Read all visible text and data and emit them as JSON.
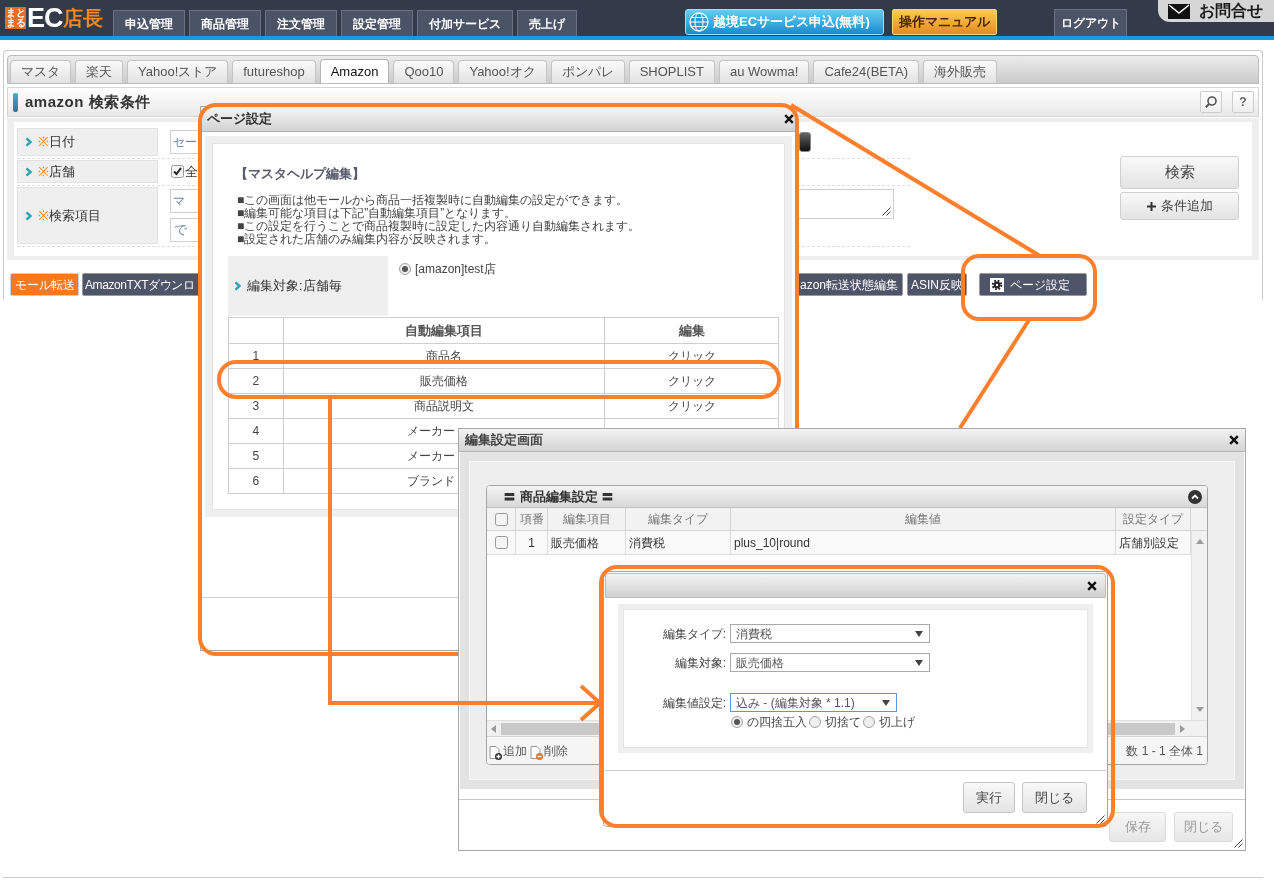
{
  "header": {
    "logo": {
      "badge": [
        "まと",
        "まる"
      ],
      "brand": "EC",
      "brand_accent": "店長"
    },
    "menu": [
      "申込管理",
      "商品管理",
      "注文管理",
      "設定管理",
      "付加サービス",
      "売上げ"
    ],
    "promo_button": "越境ECサービス申込(無料)",
    "manual_button": "操作マニュアル",
    "logout_button": "ログアウト",
    "contact_tab": "お問合せ"
  },
  "mall_tabs": [
    {
      "label": "マスタ",
      "selected": false
    },
    {
      "label": "楽天",
      "selected": false
    },
    {
      "label": "Yahoo!ストア",
      "selected": false
    },
    {
      "label": "futureshop",
      "selected": false
    },
    {
      "label": "Amazon",
      "selected": true
    },
    {
      "label": "Qoo10",
      "selected": false
    },
    {
      "label": "Yahoo!オク",
      "selected": false
    },
    {
      "label": "ポンパレ",
      "selected": false
    },
    {
      "label": "SHOPLIST",
      "selected": false
    },
    {
      "label": "au Wowma!",
      "selected": false
    },
    {
      "label": "Cafe24(BETA)",
      "selected": false
    },
    {
      "label": "海外販売",
      "selected": false
    }
  ],
  "search_panel": {
    "title": "amazon 検索条件",
    "help_button": "?",
    "conditions": [
      {
        "mark": "※",
        "label": "日付",
        "fields": [
          {
            "kind": "input",
            "value": "セー"
          },
          {
            "kind": "picker"
          }
        ]
      },
      {
        "mark": "※",
        "label": "店舗",
        "fields": [
          {
            "kind": "checkbox",
            "label": "全",
            "checked": true
          }
        ]
      },
      {
        "mark": "※",
        "label": "検索項目",
        "fields": [
          {
            "kind": "input",
            "value": "マ"
          },
          {
            "kind": "select",
            "value": "で"
          },
          {
            "kind": "textarea"
          }
        ]
      }
    ],
    "buttons": [
      {
        "kind": "search",
        "label": "検索"
      },
      {
        "kind": "add",
        "label": "条件追加"
      }
    ]
  },
  "action_buttons": {
    "left": [
      {
        "kind": "mall",
        "label": "モール転送"
      },
      {
        "kind": "dark",
        "label": "AmazonTXTダウンロ"
      }
    ],
    "right": [
      {
        "kind": "dark",
        "label": "azon転送状態編集"
      },
      {
        "kind": "dark",
        "label": "ASIN反映"
      },
      {
        "kind": "settings",
        "label": "ページ設定"
      }
    ]
  },
  "page_settings_dialog": {
    "title": "ページ設定",
    "heading": "【マスタヘルプ編集】",
    "notes": [
      "■この画面は他モールから商品一括複製時に自動編集の設定ができます。",
      "■編集可能な項目は下記”自動編集項目”となります。",
      "■この設定を行うことで商品複製時に設定した内容通り自動編集されます。",
      "■設定された店舗のみ編集内容が反映されます。"
    ],
    "target": {
      "label": "編集対象:店舗毎",
      "options": [
        {
          "label": "[amazon]test店",
          "selected": true
        }
      ]
    },
    "table": {
      "columns": [
        "自動編集項目",
        "編集"
      ],
      "rows": [
        {
          "no": "1",
          "item": "商品名",
          "edit": "クリック"
        },
        {
          "no": "2",
          "item": "販売価格",
          "edit": "クリック"
        },
        {
          "no": "3",
          "item": "商品説明文",
          "edit": "クリック"
        },
        {
          "no": "4",
          "item": "メーカー"
        },
        {
          "no": "5",
          "item": "メーカー"
        },
        {
          "no": "6",
          "item": "ブランド"
        }
      ]
    }
  },
  "edit_settings_dialog": {
    "title": "編集設定画面",
    "grid": {
      "title": "〓 商品編集設定 〓",
      "header_checked": false,
      "columns": [
        "項番",
        "編集項目",
        "編集タイプ",
        "編集値",
        "設定タイプ"
      ],
      "rows": [
        {
          "checked": false,
          "cells": [
            "1",
            "販売価格",
            "消費税",
            "plus_10|round",
            "店舗別設定"
          ]
        }
      ],
      "toolbar": [
        {
          "kind": "add",
          "label": "追加"
        },
        {
          "kind": "delete",
          "label": "削除"
        }
      ],
      "paging": "数 1 - 1 全体 1"
    },
    "buttons": [
      {
        "label": "保存",
        "disabled": true
      },
      {
        "label": "閉じる",
        "disabled": true
      }
    ]
  },
  "edit_value_dialog": {
    "fields": [
      {
        "label": "編集タイプ:",
        "value": "消費税"
      },
      {
        "label": "編集対象:",
        "value": "販売価格"
      }
    ],
    "value_setting": {
      "label": "編集値設定:",
      "value": "込み - (編集対象 * 1.1)",
      "focused": true
    },
    "rounding": [
      {
        "label": "の四捨五入",
        "selected": true
      },
      {
        "label": "切捨て",
        "selected": false
      },
      {
        "label": "切上げ",
        "selected": false
      }
    ],
    "buttons": [
      "実行",
      "閉じる"
    ]
  }
}
